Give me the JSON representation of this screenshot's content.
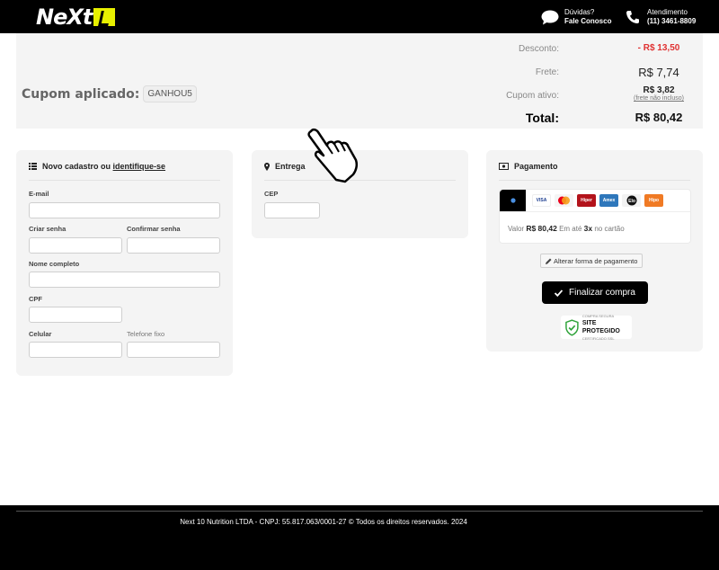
{
  "header": {
    "help_line1": "Dúvidas?",
    "help_line2": "Fale Conosco",
    "phone_line1": "Atendimento",
    "phone_line2": "(11) 3461-8809",
    "logo_text": "NeXt",
    "brand_color": "#e8f000"
  },
  "summary": {
    "coupon_label": "Cupom aplicado:",
    "coupon_code": "GANHOU5",
    "discount_label": "Desconto:",
    "discount_value": "- R$ 13,50",
    "shipping_label": "Frete:",
    "shipping_value": "R$ 7,74",
    "coupon_active_label": "Cupom ativo:",
    "coupon_active_value": "R$ 3,82",
    "coupon_active_note": "(frete não incluso)",
    "total_label": "Total:",
    "total_value": "R$ 80,42",
    "discount_color": "#e03131"
  },
  "register": {
    "title_prefix": "Novo cadastro ou",
    "title_link": "identifique-se",
    "email_label": "E-mail",
    "password_label": "Criar senha",
    "confirm_label": "Confirmar senha",
    "name_label": "Nome completo",
    "cpf_label": "CPF",
    "mobile_label": "Celular",
    "phone_label": "Telefone fixo"
  },
  "delivery": {
    "title": "Entrega",
    "cep_label": "CEP"
  },
  "payment": {
    "title": "Pagamento",
    "brands": [
      "VISA",
      "Master",
      "Hiper",
      "Amex",
      "Elo",
      "Hipo"
    ],
    "info_prefix": "Valor",
    "info_value": "R$ 80,42",
    "info_mid": "Em até",
    "info_installments": "3x",
    "info_suffix": "no cartão",
    "alter_label": "Alterar forma de pagamento",
    "finalize_label": "Finalizar compra",
    "seal_top": "COMPRA SEGURA",
    "seal_main": "SITE PROTEGIDO",
    "seal_bottom": "CERTIFICADO SSL"
  },
  "footer": {
    "text": "Next 10 Nutrition LTDA - CNPJ: 55.817.063/0001-27 © Todos os direitos reservados. 2024"
  }
}
